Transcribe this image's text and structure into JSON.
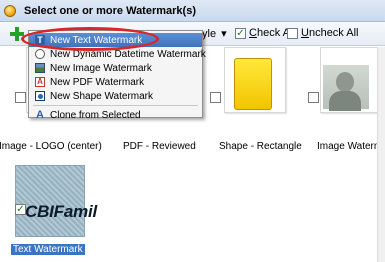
{
  "window": {
    "title": "Select one or more Watermark(s)"
  },
  "toolbar": {
    "style_label": "yle",
    "style_arrow": "▾",
    "check_all_label": "Check All",
    "check_all_underline": "C",
    "check_all_rest": "heck All",
    "uncheck_all_underline": "U",
    "uncheck_all_rest": "ncheck All",
    "check_all_checked": "✓"
  },
  "menu": {
    "items": [
      {
        "label": "New Text Watermark",
        "icon": "text-watermark-icon"
      },
      {
        "label": "New Dynamic Datetime Watermark",
        "icon": "datetime-icon"
      },
      {
        "label": "New Image Watermark",
        "icon": "image-icon"
      },
      {
        "label": "New PDF Watermark",
        "icon": "pdf-icon"
      },
      {
        "label": "New Shape Watermark",
        "icon": "shape-icon"
      }
    ],
    "clone_label": "Clone from Selected",
    "text_glyph": "T",
    "clone_glyph": "A",
    "pdf_glyph": "A"
  },
  "watermarks": [
    {
      "caption": "Image - LOGO (center)",
      "checked": false
    },
    {
      "caption": "PDF - Reviewed",
      "checked": false
    },
    {
      "caption": "Shape - Rectangle",
      "checked": false
    },
    {
      "caption": "Image Watermark",
      "checked": false
    },
    {
      "caption": "Text Watermark",
      "checked": true,
      "preview_text": "CBIFamil"
    }
  ],
  "item_checked_glyph": "✓",
  "colors": {
    "highlight": "#3b74c3",
    "annotation_oval": "#d6282a",
    "shape_fill": "#f7d618",
    "text_preview_bg": "#9cb8c8"
  }
}
